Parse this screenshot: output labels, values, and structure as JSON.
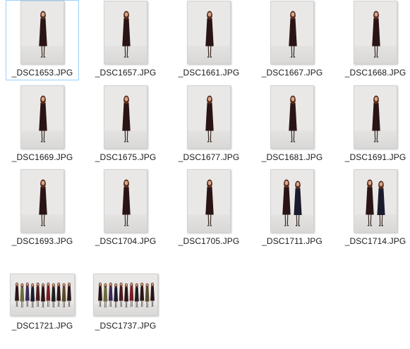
{
  "files": [
    {
      "name": "_DSC1653.JPG",
      "kind": "single-portrait",
      "selected": true
    },
    {
      "name": "_DSC1657.JPG",
      "kind": "single-portrait",
      "selected": false
    },
    {
      "name": "_DSC1661.JPG",
      "kind": "single-portrait",
      "selected": false
    },
    {
      "name": "_DSC1667.JPG",
      "kind": "single-portrait",
      "selected": false
    },
    {
      "name": "_DSC1668.JPG",
      "kind": "single-portrait",
      "selected": false
    },
    {
      "name": "_DSC1669.JPG",
      "kind": "single-portrait",
      "selected": false
    },
    {
      "name": "_DSC1675.JPG",
      "kind": "single-portrait",
      "selected": false
    },
    {
      "name": "_DSC1677.JPG",
      "kind": "single-portrait",
      "selected": false
    },
    {
      "name": "_DSC1681.JPG",
      "kind": "single-portrait",
      "selected": false
    },
    {
      "name": "_DSC1691.JPG",
      "kind": "single-portrait",
      "selected": false
    },
    {
      "name": "_DSC1693.JPG",
      "kind": "single-portrait",
      "selected": false
    },
    {
      "name": "_DSC1704.JPG",
      "kind": "single-portrait",
      "selected": false
    },
    {
      "name": "_DSC1705.JPG",
      "kind": "single-portrait",
      "selected": false
    },
    {
      "name": "_DSC1711.JPG",
      "kind": "pair-portrait",
      "selected": false
    },
    {
      "name": "_DSC1714.JPG",
      "kind": "pair-portrait",
      "selected": false
    },
    {
      "name": "_DSC1721.JPG",
      "kind": "group-landscape",
      "selected": false
    },
    {
      "name": "_DSC1737.JPG",
      "kind": "group-landscape",
      "selected": false
    }
  ],
  "colors": {
    "selection_border": "#99d1ff",
    "backdrop": "#e9e8e7",
    "coat": "#2a1416",
    "hair": "#5a2e1e",
    "skin": "#d9a88c"
  }
}
